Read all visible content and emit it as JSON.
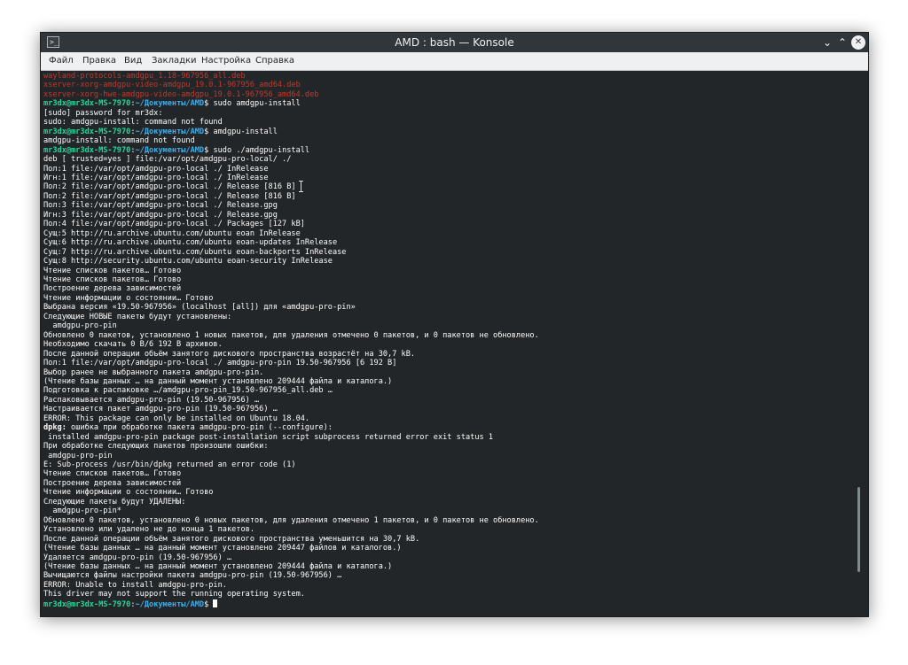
{
  "window": {
    "title": "AMD : bash — Konsole",
    "app_icon_glyph": ">_",
    "minimize_glyph": "⌄",
    "maximize_glyph": "⌃",
    "close_glyph": "✕"
  },
  "menu": {
    "items": [
      "Файл",
      "Правка",
      "Вид",
      "Закладки",
      "Настройка",
      "Справка"
    ]
  },
  "colors": {
    "prompt_user": "#1cdc9a",
    "prompt_path": "#3daee9",
    "error_text": "#c0392b",
    "terminal_bg": "#232629"
  },
  "terminal": {
    "lines": [
      [
        {
          "t": "wayland-protocols-amdgpu_1.18-967956_all.deb",
          "s": "red"
        }
      ],
      [
        {
          "t": "xserver-xorg-amdgpu-video-amdgpu_19.0.1-967956_amd64.deb",
          "s": "red"
        }
      ],
      [
        {
          "t": "xserver-xorg-hwe-amdgpu-video-amdgpu_19.0.1-967956_amd64.deb",
          "s": "red"
        }
      ],
      [
        {
          "t": "mr3dx@mr3dx-MS-7970",
          "s": "green"
        },
        {
          "t": ":",
          "s": ""
        },
        {
          "t": "~/Документы/AMD",
          "s": "blue"
        },
        {
          "t": "$ sudo amdgpu-install",
          "s": ""
        }
      ],
      [
        {
          "t": "[sudo] password for mr3dx:",
          "s": ""
        }
      ],
      [
        {
          "t": "sudo: amdgpu-install: command not found",
          "s": ""
        }
      ],
      [
        {
          "t": "mr3dx@mr3dx-MS-7970",
          "s": "green"
        },
        {
          "t": ":",
          "s": ""
        },
        {
          "t": "~/Документы/AMD",
          "s": "blue"
        },
        {
          "t": "$ amdgpu-install",
          "s": ""
        }
      ],
      [
        {
          "t": "amdgpu-install: command not found",
          "s": ""
        }
      ],
      [
        {
          "t": "mr3dx@mr3dx-MS-7970",
          "s": "green"
        },
        {
          "t": ":",
          "s": ""
        },
        {
          "t": "~/Документы/AMD",
          "s": "blue"
        },
        {
          "t": "$ sudo ./amdgpu-install",
          "s": ""
        }
      ],
      [
        {
          "t": "deb [ trusted=yes ] file:/var/opt/amdgpu-pro-local/ ./",
          "s": ""
        }
      ],
      [
        {
          "t": "Пол:1 file:/var/opt/amdgpu-pro-local ./ InRelease",
          "s": ""
        }
      ],
      [
        {
          "t": "Игн:1 file:/var/opt/amdgpu-pro-local ./ InRelease",
          "s": ""
        }
      ],
      [
        {
          "t": "Пол:2 file:/var/opt/amdgpu-pro-local ./ Release [816 B]",
          "s": ""
        }
      ],
      [
        {
          "t": "Пол:2 file:/var/opt/amdgpu-pro-local ./ Release [816 B]",
          "s": ""
        }
      ],
      [
        {
          "t": "Пол:3 file:/var/opt/amdgpu-pro-local ./ Release.gpg",
          "s": ""
        }
      ],
      [
        {
          "t": "Игн:3 file:/var/opt/amdgpu-pro-local ./ Release.gpg",
          "s": ""
        }
      ],
      [
        {
          "t": "Пол:4 file:/var/opt/amdgpu-pro-local ./ Packages [127 kB]",
          "s": ""
        }
      ],
      [
        {
          "t": "Сущ:5 http://ru.archive.ubuntu.com/ubuntu eoan InRelease",
          "s": ""
        }
      ],
      [
        {
          "t": "Сущ:6 http://ru.archive.ubuntu.com/ubuntu eoan-updates InRelease",
          "s": ""
        }
      ],
      [
        {
          "t": "Сущ:7 http://ru.archive.ubuntu.com/ubuntu eoan-backports InRelease",
          "s": ""
        }
      ],
      [
        {
          "t": "Сущ:8 http://security.ubuntu.com/ubuntu eoan-security InRelease",
          "s": ""
        }
      ],
      [
        {
          "t": "Чтение списков пакетов… Готово",
          "s": ""
        }
      ],
      [
        {
          "t": "Чтение списков пакетов… Готово",
          "s": ""
        }
      ],
      [
        {
          "t": "Построение дерева зависимостей",
          "s": ""
        }
      ],
      [
        {
          "t": "Чтение информации о состоянии… Готово",
          "s": ""
        }
      ],
      [
        {
          "t": "Выбрана версия «19.50-967956» (localhost [all]) для «amdgpu-pro-pin»",
          "s": ""
        }
      ],
      [
        {
          "t": "Следующие НОВЫЕ пакеты будут установлены:",
          "s": ""
        }
      ],
      [
        {
          "t": "  amdgpu-pro-pin",
          "s": ""
        }
      ],
      [
        {
          "t": "Обновлено 0 пакетов, установлено 1 новых пакетов, для удаления отмечено 0 пакетов, и 0 пакетов не обновлено.",
          "s": ""
        }
      ],
      [
        {
          "t": "Необходимо скачать 0 B/6 192 B архивов.",
          "s": ""
        }
      ],
      [
        {
          "t": "После данной операции объём занятого дискового пространства возрастёт на 30,7 kB.",
          "s": ""
        }
      ],
      [
        {
          "t": "Пол:1 file:/var/opt/amdgpu-pro-local ./ amdgpu-pro-pin 19.50-967956 [6 192 B]",
          "s": ""
        }
      ],
      [
        {
          "t": "Выбор ранее не выбранного пакета amdgpu-pro-pin.",
          "s": ""
        }
      ],
      [
        {
          "t": "(Чтение базы данных … на данный момент установлено 209444 файла и каталога.)",
          "s": ""
        }
      ],
      [
        {
          "t": "Подготовка к распаковке …/amdgpu-pro-pin_19.50-967956_all.deb …",
          "s": ""
        }
      ],
      [
        {
          "t": "Распаковывается amdgpu-pro-pin (19.50-967956) …",
          "s": ""
        }
      ],
      [
        {
          "t": "Настраивается пакет amdgpu-pro-pin (19.50-967956) …",
          "s": ""
        }
      ],
      [
        {
          "t": "ERROR: This package can only be installed on Ubuntu 18.04.",
          "s": ""
        }
      ],
      [
        {
          "t": "dpkg:",
          "s": "bold"
        },
        {
          "t": " ошибка при обработке пакета amdgpu-pro-pin (--configure):",
          "s": ""
        }
      ],
      [
        {
          "t": " installed amdgpu-pro-pin package post-installation script subprocess returned error exit status 1",
          "s": ""
        }
      ],
      [
        {
          "t": "При обработке следующих пакетов произошли ошибки:",
          "s": ""
        }
      ],
      [
        {
          "t": " amdgpu-pro-pin",
          "s": ""
        }
      ],
      [
        {
          "t": "E: Sub-process /usr/bin/dpkg returned an error code (1)",
          "s": ""
        }
      ],
      [
        {
          "t": "Чтение списков пакетов… Готово",
          "s": ""
        }
      ],
      [
        {
          "t": "Построение дерева зависимостей",
          "s": ""
        }
      ],
      [
        {
          "t": "Чтение информации о состоянии… Готово",
          "s": ""
        }
      ],
      [
        {
          "t": "Следующие пакеты будут УДАЛЕНЫ:",
          "s": ""
        }
      ],
      [
        {
          "t": "  amdgpu-pro-pin*",
          "s": ""
        }
      ],
      [
        {
          "t": "Обновлено 0 пакетов, установлено 0 новых пакетов, для удаления отмечено 1 пакетов, и 0 пакетов не обновлено.",
          "s": ""
        }
      ],
      [
        {
          "t": "Установлено или удалено не до конца 1 пакетов.",
          "s": ""
        }
      ],
      [
        {
          "t": "После данной операции объём занятого дискового пространства уменьшится на 30,7 kB.",
          "s": ""
        }
      ],
      [
        {
          "t": "(Чтение базы данных … на данный момент установлено 209447 файлов и каталогов.)",
          "s": ""
        }
      ],
      [
        {
          "t": "Удаляется amdgpu-pro-pin (19.50-967956) …",
          "s": ""
        }
      ],
      [
        {
          "t": "(Чтение базы данных … на данный момент установлено 209444 файла и каталога.)",
          "s": ""
        }
      ],
      [
        {
          "t": "Вычищаются файлы настройки пакета amdgpu-pro-pin (19.50-967956) …",
          "s": ""
        }
      ],
      [
        {
          "t": "ERROR: Unable to install amdgpu-pro-pin.",
          "s": ""
        }
      ],
      [
        {
          "t": "This driver may not support the running operating system.",
          "s": ""
        }
      ],
      [
        {
          "t": "mr3dx@mr3dx-MS-7970",
          "s": "green"
        },
        {
          "t": ":",
          "s": ""
        },
        {
          "t": "~/Документы/AMD",
          "s": "blue"
        },
        {
          "t": "$ ",
          "s": ""
        }
      ]
    ]
  }
}
